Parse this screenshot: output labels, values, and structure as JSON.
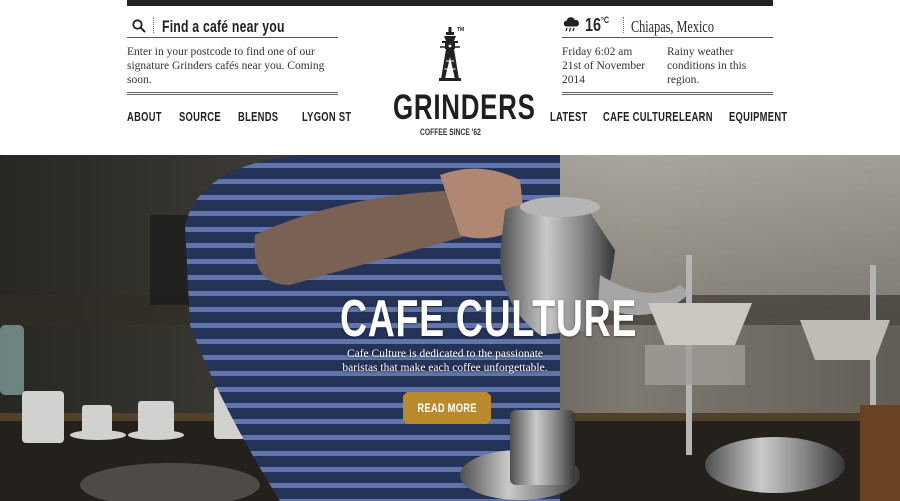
{
  "search": {
    "heading": "Find a café near you",
    "description": "Enter in your postcode to find one of our signature Grinders cafés near you. Coming soon."
  },
  "weather": {
    "temperature": "16",
    "unit": "°C",
    "location": "Chiapas, Mexico",
    "day_time": "Friday 6:02 am",
    "date": "21st of November 2014",
    "conditions": "Rainy weather conditions in this region."
  },
  "logo": {
    "brand": "GRINDERS",
    "tagline": "COFFEE SINCE '62",
    "mark": "TM"
  },
  "nav_left": [
    "ABOUT",
    "SOURCE",
    "BLENDS",
    "LYGON ST"
  ],
  "nav_right": [
    "LATEST",
    "CAFE CULTURE",
    "LEARN",
    "EQUIPMENT"
  ],
  "hero": {
    "title": "CAFE CULTURE",
    "subtitle": "Cafe Culture is dedicated to the passionate baristas that make each coffee unforgettable.",
    "button_label": "READ MORE"
  },
  "colors": {
    "accent": "#b9892c",
    "text": "#222222",
    "topbar": "#222222"
  },
  "icons": {
    "search": "search-icon",
    "weather": "rain-cloud-icon",
    "logo": "grinder-tower-icon"
  }
}
